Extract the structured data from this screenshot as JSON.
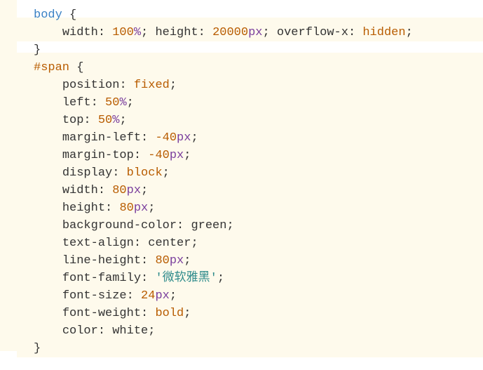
{
  "code": {
    "selector_body": "body",
    "brace_open": " {",
    "brace_close": "}",
    "body_line": {
      "prop1": "width",
      "val1_num": "100",
      "val1_unit": "%",
      "prop2": "height",
      "val2_num": "20000",
      "val2_unit": "px",
      "prop3": "overflow-x",
      "val3": "hidden"
    },
    "selector_span": "#span",
    "rules": {
      "position": {
        "prop": "position",
        "val_kw": "fixed"
      },
      "left": {
        "prop": "left",
        "num": "50",
        "unit": "%"
      },
      "top": {
        "prop": "top",
        "num": "50",
        "unit": "%"
      },
      "margin_left": {
        "prop": "margin-left",
        "num": "-40",
        "unit": "px"
      },
      "margin_top": {
        "prop": "margin-top",
        "num": "-40",
        "unit": "px"
      },
      "display": {
        "prop": "display",
        "val_kw": "block"
      },
      "width": {
        "prop": "width",
        "num": "80",
        "unit": "px"
      },
      "height": {
        "prop": "height",
        "num": "80",
        "unit": "px"
      },
      "background_color": {
        "prop": "background-color",
        "val_plain": "green"
      },
      "text_align": {
        "prop": "text-align",
        "val_plain": "center"
      },
      "line_height": {
        "prop": "line-height",
        "num": "80",
        "unit": "px"
      },
      "font_family": {
        "prop": "font-family",
        "val_str": "'微软雅黑'"
      },
      "font_size": {
        "prop": "font-size",
        "num": "24",
        "unit": "px"
      },
      "font_weight": {
        "prop": "font-weight",
        "val_kw": "bold"
      },
      "color": {
        "prop": "color",
        "val_plain": "white"
      }
    },
    "colon_sp": ": ",
    "semi": ";",
    "indent1": "    ",
    "indent2": "        "
  }
}
